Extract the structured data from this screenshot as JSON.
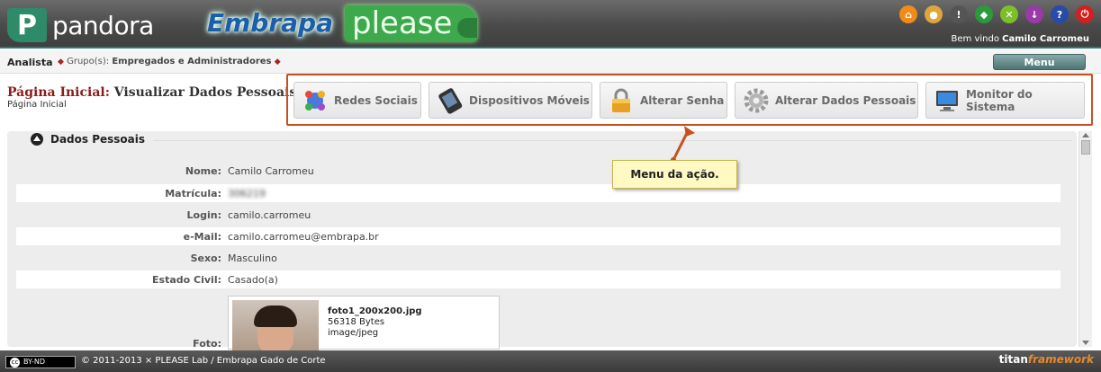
{
  "header": {
    "logo_pandora": "pandora",
    "logo_pandora_mark": "P",
    "logo_embrapa": "Embrapa",
    "logo_please": "please",
    "icons": [
      {
        "name": "home-icon",
        "glyph": "⌂",
        "color": "#f08a1a"
      },
      {
        "name": "user-icon",
        "glyph": "●",
        "color": "#e0a63a"
      },
      {
        "name": "alert-icon",
        "glyph": "!",
        "color": "#555"
      },
      {
        "name": "brazil-flag-icon",
        "glyph": "◆",
        "color": "#2a9a3a"
      },
      {
        "name": "tools-icon",
        "glyph": "✕",
        "color": "#7cbf2a"
      },
      {
        "name": "download-icon",
        "glyph": "↓",
        "color": "#9a3aa8"
      },
      {
        "name": "help-shield-icon",
        "glyph": "?",
        "color": "#2a4aa8"
      },
      {
        "name": "power-icon",
        "glyph": "⏻",
        "color": "#d02020"
      }
    ],
    "welcome_prefix": "Bem vindo",
    "welcome_user": "Camilo Carromeu"
  },
  "crumb": {
    "role": "Analista",
    "groups_label": "Grupo(s):",
    "groups_value": "Empregados e Administradores",
    "menu_label": "Menu"
  },
  "page": {
    "title_red": "Página Inicial:",
    "title_rest": "Visualizar Dados Pessoais",
    "subtitle": "Página Inicial"
  },
  "actions": [
    {
      "label": "Redes Sociais",
      "icon": "social-networks-icon"
    },
    {
      "label": "Dispositivos Móveis",
      "icon": "mobile-device-icon"
    },
    {
      "label": "Alterar Senha",
      "icon": "padlock-icon"
    },
    {
      "label": "Alterar Dados Pessoais",
      "icon": "gear-icon"
    },
    {
      "label": "Monitor do Sistema",
      "icon": "monitor-icon"
    }
  ],
  "tooltip": "Menu da ação.",
  "section": {
    "title": "Dados Pessoais",
    "fields": [
      {
        "label": "Nome:",
        "value": "Camilo Carromeu"
      },
      {
        "label": "Matrícula:",
        "value": "306219"
      },
      {
        "label": "Login:",
        "value": "camilo.carromeu"
      },
      {
        "label": "e-Mail:",
        "value": "camilo.carromeu@embrapa.br"
      },
      {
        "label": "Sexo:",
        "value": "Masculino"
      },
      {
        "label": "Estado Civil:",
        "value": "Casado(a)"
      }
    ],
    "photo_label": "Foto:",
    "photo": {
      "filename": "foto1_200x200.jpg",
      "size": "56318 Bytes",
      "mime": "image/jpeg"
    }
  },
  "footer": {
    "cc_badge": "BY-ND",
    "cc_mark": "cc",
    "copyright": "© 2011-2013 × PLEASE Lab / Embrapa Gado de Corte",
    "brand_a": "titan",
    "brand_b": "framework"
  }
}
